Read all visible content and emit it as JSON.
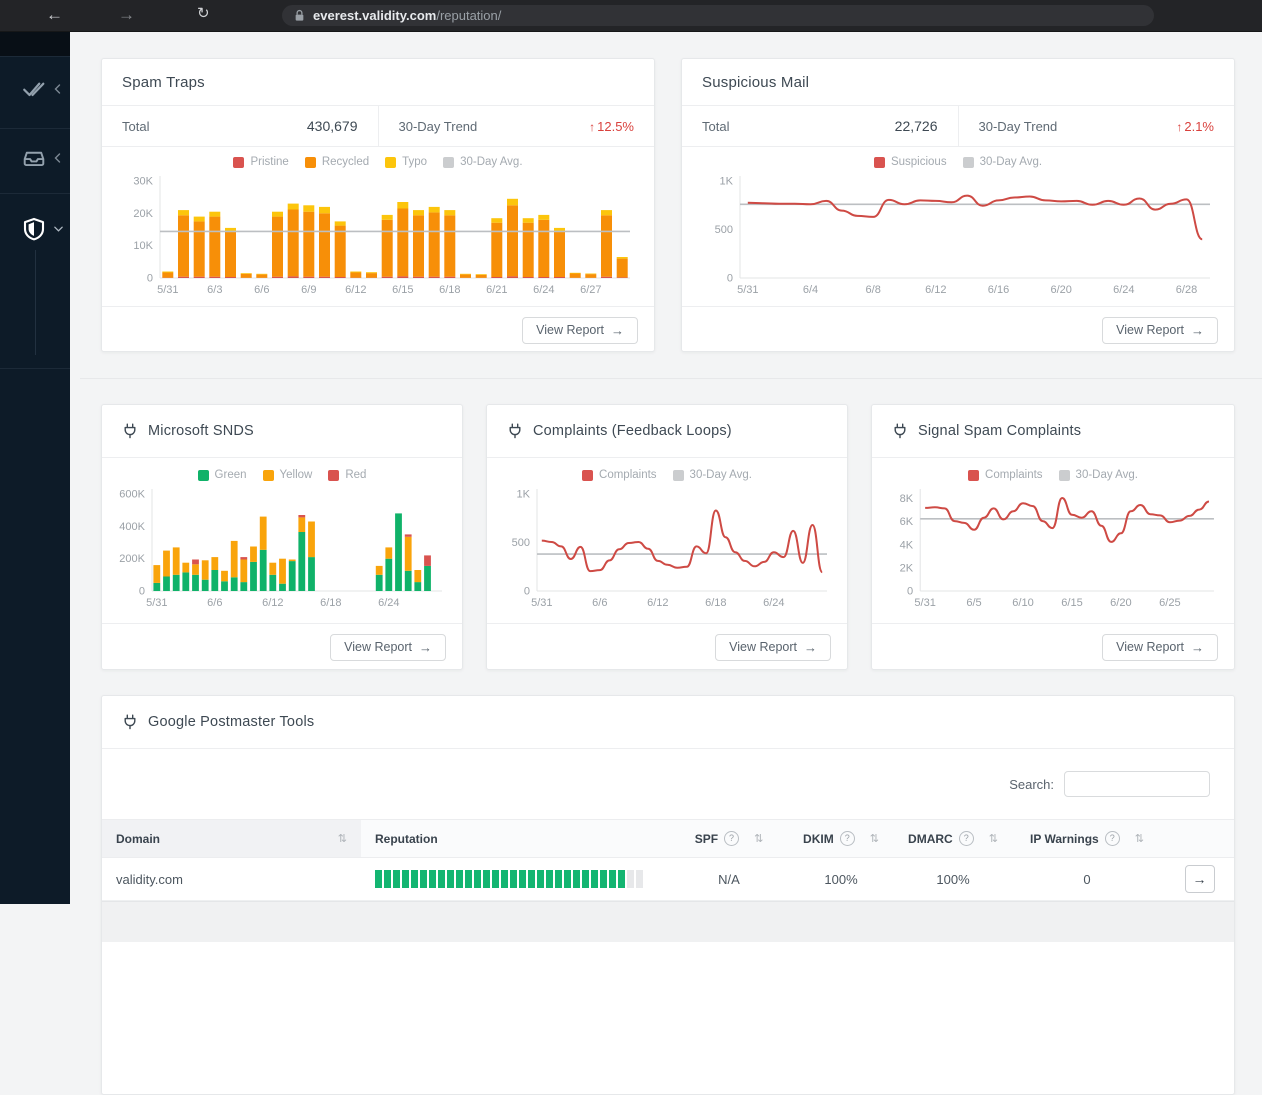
{
  "browser": {
    "host": "everest.validity.com",
    "path": "/reputation/"
  },
  "sidebar": {
    "items": [
      {
        "icon": "double-check-icon",
        "state": "collapsed"
      },
      {
        "icon": "inbox-tray-icon",
        "state": "collapsed"
      },
      {
        "icon": "shield-icon",
        "state": "expanded"
      }
    ]
  },
  "cards": {
    "spam_traps": {
      "title": "Spam Traps",
      "total_label": "Total",
      "total": "430,679",
      "trend_label": "30-Day Trend",
      "trend": "12.5%",
      "view_report": "View Report"
    },
    "suspicious_mail": {
      "title": "Suspicious Mail",
      "total_label": "Total",
      "total": "22,726",
      "trend_label": "30-Day Trend",
      "trend": "2.1%",
      "view_report": "View Report"
    },
    "snds": {
      "title": "Microsoft SNDS",
      "view_report": "View Report"
    },
    "fbl": {
      "title": "Complaints (Feedback Loops)",
      "view_report": "View Report"
    },
    "signal": {
      "title": "Signal Spam Complaints",
      "view_report": "View Report"
    },
    "gpt": {
      "title": "Google Postmaster Tools",
      "search_label": "Search:",
      "table": {
        "columns": [
          {
            "label": "Domain",
            "sortable": true
          },
          {
            "label": "Reputation"
          },
          {
            "label": "SPF",
            "help": true,
            "sortable": true
          },
          {
            "label": "DKIM",
            "help": true,
            "sortable": true
          },
          {
            "label": "DMARC",
            "help": true,
            "sortable": true
          },
          {
            "label": "IP Warnings",
            "help": true,
            "sortable": true
          }
        ],
        "row": {
          "domain": "validity.com",
          "reputation_segments": 30,
          "reputation_filled": 28,
          "spf": "N/A",
          "dkim": "100%",
          "dmarc": "100%",
          "ip_warnings": "0"
        }
      }
    }
  },
  "chart_data": [
    {
      "id": "spam-traps",
      "type": "bar",
      "title": "Spam Traps",
      "n": 30,
      "unit": "thousands",
      "ymax": 30,
      "avg": 14.4,
      "grid": false,
      "legend_position": "top",
      "yticks": [
        {
          "v": 0,
          "label": "0"
        },
        {
          "v": 10,
          "label": "10K"
        },
        {
          "v": 20,
          "label": "20K"
        },
        {
          "v": 30,
          "label": "30K"
        }
      ],
      "xticks": [
        {
          "i": 0,
          "label": "5/31"
        },
        {
          "i": 3,
          "label": "6/3"
        },
        {
          "i": 6,
          "label": "6/6"
        },
        {
          "i": 9,
          "label": "6/9"
        },
        {
          "i": 12,
          "label": "6/12"
        },
        {
          "i": 15,
          "label": "6/15"
        },
        {
          "i": 18,
          "label": "6/18"
        },
        {
          "i": 21,
          "label": "6/21"
        },
        {
          "i": 24,
          "label": "6/24"
        },
        {
          "i": 27,
          "label": "6/27"
        }
      ],
      "legend": [
        {
          "label": "Pristine",
          "color": "#d9534f"
        },
        {
          "label": "Recycled",
          "color": "#f78f08"
        },
        {
          "label": "Typo",
          "color": "#fcc50c"
        },
        {
          "label": "30-Day Avg.",
          "color": "#cbcdcf"
        }
      ],
      "series": [
        {
          "name": "Pristine",
          "color": "#d9534f",
          "values": [
            0.1,
            0.4,
            0.4,
            0.4,
            0.3,
            0.05,
            0.05,
            0.4,
            0.5,
            0.4,
            0.4,
            0.3,
            0.1,
            0.1,
            0.4,
            0.5,
            0.4,
            0.4,
            0.4,
            0.05,
            0.05,
            0.3,
            0.5,
            0.3,
            0.3,
            0.3,
            0.05,
            0.05,
            0.4,
            0.2
          ]
        },
        {
          "name": "Recycled",
          "color": "#f78f08",
          "values": [
            1.6,
            19.0,
            17.1,
            18.6,
            14.0,
            1.25,
            1.05,
            18.6,
            20.7,
            20.1,
            19.6,
            15.9,
            1.6,
            1.4,
            17.6,
            21.0,
            19.0,
            19.9,
            19.0,
            1.05,
            0.95,
            16.8,
            22.0,
            16.8,
            17.7,
            14.0,
            1.35,
            1.15,
            19.0,
            5.8
          ]
        },
        {
          "name": "Typo",
          "color": "#fcc50c",
          "values": [
            0.3,
            1.6,
            1.5,
            1.5,
            1.2,
            0.2,
            0.2,
            1.5,
            1.8,
            2.0,
            2.0,
            1.3,
            0.3,
            0.3,
            1.5,
            2.0,
            1.6,
            1.7,
            1.6,
            0.2,
            0.2,
            1.4,
            2.0,
            1.4,
            1.5,
            1.2,
            0.2,
            0.2,
            1.6,
            0.5
          ]
        }
      ]
    },
    {
      "id": "suspicious-mail",
      "type": "line",
      "title": "Suspicious Mail",
      "n": 30,
      "ymax": 1000,
      "avg": 760,
      "color": "#ce4a44",
      "grid": false,
      "legend_position": "top",
      "yticks": [
        {
          "v": 0,
          "label": "0"
        },
        {
          "v": 500,
          "label": "500"
        },
        {
          "v": 1000,
          "label": "1K"
        }
      ],
      "xticks": [
        {
          "i": 0,
          "label": "5/31"
        },
        {
          "i": 4,
          "label": "6/4"
        },
        {
          "i": 8,
          "label": "6/8"
        },
        {
          "i": 12,
          "label": "6/12"
        },
        {
          "i": 16,
          "label": "6/16"
        },
        {
          "i": 20,
          "label": "6/20"
        },
        {
          "i": 24,
          "label": "6/24"
        },
        {
          "i": 28,
          "label": "6/28"
        }
      ],
      "legend": [
        {
          "label": "Suspicious",
          "color": "#d9534f"
        },
        {
          "label": "30-Day Avg.",
          "color": "#cbcdcf"
        }
      ],
      "values": [
        775,
        770,
        765,
        765,
        760,
        795,
        695,
        640,
        630,
        805,
        760,
        800,
        795,
        780,
        850,
        745,
        800,
        830,
        840,
        800,
        790,
        795,
        755,
        795,
        755,
        820,
        705,
        765,
        810,
        400
      ]
    },
    {
      "id": "snds",
      "type": "bar",
      "title": "Microsoft SNDS",
      "n": 30,
      "unit": "thousands",
      "ymax": 600,
      "grid": false,
      "legend_position": "top",
      "yticks": [
        {
          "v": 0,
          "label": "0"
        },
        {
          "v": 200,
          "label": "200K"
        },
        {
          "v": 400,
          "label": "400K"
        },
        {
          "v": 600,
          "label": "600K"
        }
      ],
      "xticks": [
        {
          "i": 0,
          "label": "5/31"
        },
        {
          "i": 6,
          "label": "6/6"
        },
        {
          "i": 12,
          "label": "6/12"
        },
        {
          "i": 18,
          "label": "6/18"
        },
        {
          "i": 24,
          "label": "6/24"
        }
      ],
      "legend": [
        {
          "label": "Green",
          "color": "#10b269"
        },
        {
          "label": "Yellow",
          "color": "#f9a40b"
        },
        {
          "label": "Red",
          "color": "#d9534f"
        }
      ],
      "series": [
        {
          "name": "Green",
          "color": "#10b269",
          "values": [
            50,
            90,
            100,
            115,
            100,
            70,
            130,
            60,
            85,
            55,
            180,
            255,
            100,
            45,
            185,
            365,
            210,
            0,
            0,
            0,
            0,
            0,
            0,
            100,
            200,
            480,
            125,
            55,
            155,
            0
          ]
        },
        {
          "name": "Yellow",
          "color": "#f9a40b",
          "values": [
            110,
            160,
            170,
            60,
            65,
            120,
            80,
            65,
            225,
            140,
            95,
            205,
            75,
            155,
            10,
            90,
            220,
            0,
            0,
            0,
            0,
            0,
            0,
            55,
            70,
            0,
            210,
            75,
            0,
            0
          ]
        },
        {
          "name": "Red",
          "color": "#d9534f",
          "values": [
            0,
            0,
            0,
            0,
            30,
            0,
            0,
            0,
            0,
            15,
            0,
            0,
            0,
            0,
            0,
            15,
            0,
            0,
            0,
            0,
            0,
            0,
            0,
            0,
            0,
            0,
            15,
            0,
            65,
            0
          ]
        }
      ]
    },
    {
      "id": "fbl",
      "type": "line",
      "title": "Complaints (Feedback Loops)",
      "n": 30,
      "ymax": 1000,
      "avg": 380,
      "color": "#ce4a44",
      "grid": false,
      "legend_position": "top",
      "yticks": [
        {
          "v": 0,
          "label": "0"
        },
        {
          "v": 500,
          "label": "500"
        },
        {
          "v": 1000,
          "label": "1K"
        }
      ],
      "xticks": [
        {
          "i": 0,
          "label": "5/31"
        },
        {
          "i": 6,
          "label": "6/6"
        },
        {
          "i": 12,
          "label": "6/12"
        },
        {
          "i": 18,
          "label": "6/18"
        },
        {
          "i": 24,
          "label": "6/24"
        }
      ],
      "legend": [
        {
          "label": "Complaints",
          "color": "#d9534f"
        },
        {
          "label": "30-Day Avg.",
          "color": "#cbcdcf"
        }
      ],
      "values": [
        520,
        505,
        460,
        330,
        455,
        205,
        215,
        315,
        430,
        495,
        505,
        435,
        310,
        270,
        240,
        250,
        460,
        390,
        830,
        555,
        400,
        310,
        255,
        300,
        400,
        350,
        620,
        290,
        680,
        195
      ]
    },
    {
      "id": "signal",
      "type": "line",
      "title": "Signal Spam Complaints",
      "n": 30,
      "unit": "thousands",
      "ymax": 8.4,
      "avg": 6.25,
      "color": "#ce4a44",
      "grid": false,
      "legend_position": "top",
      "yticks": [
        {
          "v": 0,
          "label": "0"
        },
        {
          "v": 2,
          "label": "2K"
        },
        {
          "v": 4,
          "label": "4K"
        },
        {
          "v": 6,
          "label": "6K"
        },
        {
          "v": 8,
          "label": "8K"
        }
      ],
      "xticks": [
        {
          "i": 0,
          "label": "5/31"
        },
        {
          "i": 5,
          "label": "6/5"
        },
        {
          "i": 10,
          "label": "6/10"
        },
        {
          "i": 15,
          "label": "6/15"
        },
        {
          "i": 20,
          "label": "6/20"
        },
        {
          "i": 25,
          "label": "6/25"
        }
      ],
      "legend": [
        {
          "label": "Complaints",
          "color": "#d9534f"
        },
        {
          "label": "30-Day Avg.",
          "color": "#cbcdcf"
        }
      ],
      "values": [
        7.2,
        7.25,
        7.15,
        6.05,
        5.9,
        5.3,
        6.35,
        7.15,
        6.2,
        6.9,
        7.6,
        7.35,
        6.05,
        5.45,
        8.05,
        6.6,
        6.35,
        6.9,
        5.65,
        4.25,
        5.0,
        6.9,
        7.45,
        6.65,
        6.55,
        5.95,
        6.1,
        6.5,
        7.05,
        7.75
      ]
    }
  ]
}
